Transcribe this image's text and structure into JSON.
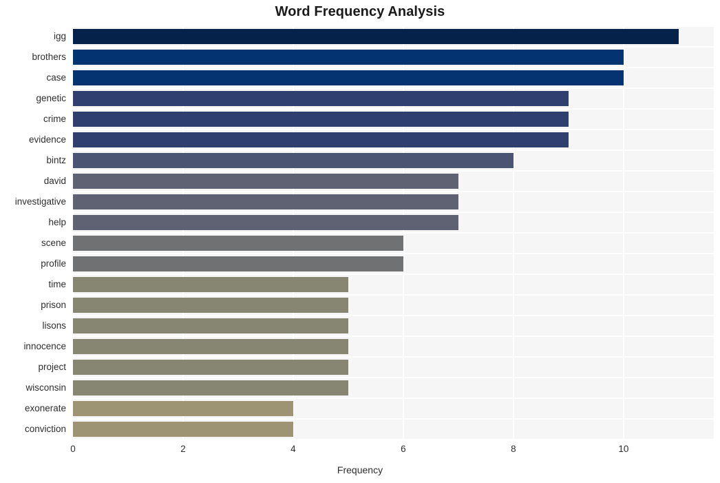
{
  "chart_data": {
    "type": "bar",
    "orientation": "horizontal",
    "title": "Word Frequency Analysis",
    "xlabel": "Frequency",
    "ylabel": "",
    "xlim": [
      0,
      11.64
    ],
    "xticks": [
      0,
      2,
      4,
      6,
      8,
      10
    ],
    "xticklabels": [
      "0",
      "2",
      "4",
      "6",
      "8",
      "10"
    ],
    "grid": true,
    "legend": null,
    "categories": [
      "igg",
      "brothers",
      "case",
      "genetic",
      "crime",
      "evidence",
      "bintz",
      "david",
      "investigative",
      "help",
      "scene",
      "profile",
      "time",
      "prison",
      "lisons",
      "innocence",
      "project",
      "wisconsin",
      "exonerate",
      "conviction"
    ],
    "values": [
      11,
      10,
      10,
      9,
      9,
      9,
      8,
      7,
      7,
      7,
      6,
      6,
      5,
      5,
      5,
      5,
      5,
      5,
      4,
      4
    ],
    "bar_colors": [
      "#05224a",
      "#043371",
      "#053372",
      "#2f4070",
      "#2f4070",
      "#2f4070",
      "#4b5472",
      "#5e6272",
      "#5e6272",
      "#5e6272",
      "#6f7173",
      "#6f7173",
      "#868672",
      "#868672",
      "#868672",
      "#868672",
      "#868672",
      "#868672",
      "#9d9474",
      "#9d9474"
    ],
    "plot_background": "#f6f6f7",
    "grid_color": "#ffffff",
    "figure_background": "#ffffff",
    "text_color": "#2e2e2e"
  }
}
